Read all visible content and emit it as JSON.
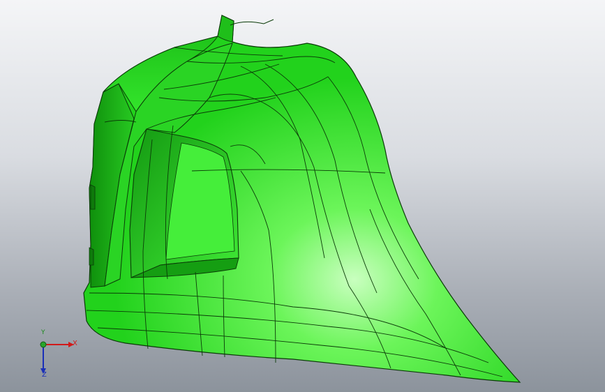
{
  "viewport": {
    "background_top": "#f4f5f7",
    "background_bottom": "#8c939c"
  },
  "model": {
    "icon": "cad-part-model",
    "color": "#22e61f",
    "edge_color": "#0b3b08"
  },
  "triad": {
    "x_label": "X",
    "y_label": "Y",
    "z_label": "Z",
    "x_color": "#d11a1a",
    "y_color": "#1d8a1d",
    "z_color": "#1a2fb8"
  }
}
